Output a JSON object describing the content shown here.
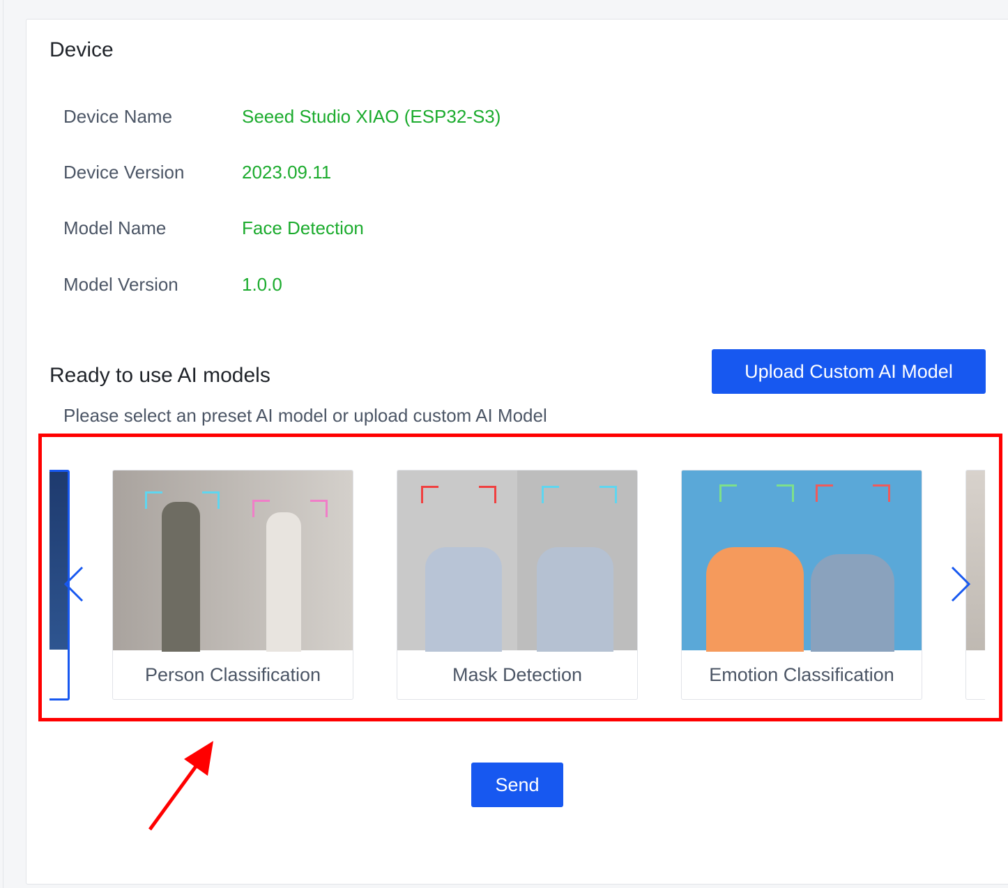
{
  "device": {
    "title": "Device",
    "rows": [
      {
        "label": "Device Name",
        "value": "Seeed Studio XIAO (ESP32-S3)"
      },
      {
        "label": "Device Version",
        "value": "2023.09.11"
      },
      {
        "label": "Model Name",
        "value": "Face Detection"
      },
      {
        "label": "Model Version",
        "value": "1.0.0"
      }
    ]
  },
  "models": {
    "title": "Ready to use AI models",
    "subtitle": "Please select an preset AI model or upload custom AI Model",
    "upload_label": "Upload Custom AI Model",
    "cards": [
      {
        "label": "Person Classification"
      },
      {
        "label": "Mask Detection"
      },
      {
        "label": "Emotion Classification"
      }
    ],
    "prev_icon": "chevron-left-icon",
    "next_icon": "chevron-right-icon"
  },
  "send_label": "Send",
  "colors": {
    "accent": "#1758f0",
    "value_green": "#1bab2d",
    "annotation_red": "#ff0000"
  }
}
